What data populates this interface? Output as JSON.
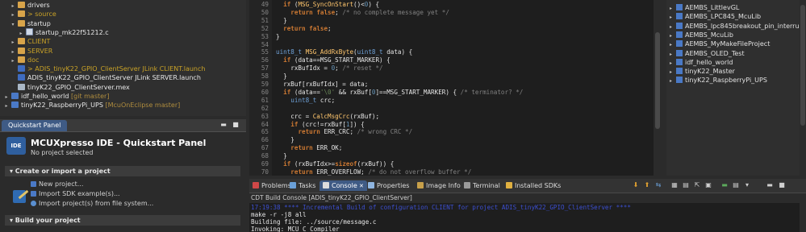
{
  "explorer": {
    "rows": [
      {
        "indent": 1,
        "twisty": "▸",
        "icon": "folder",
        "label": "drivers",
        "cls": "c-white"
      },
      {
        "indent": 1,
        "twisty": "▸",
        "icon": "folder",
        "label": "> source",
        "cls": "c-gold"
      },
      {
        "indent": 1,
        "twisty": "▾",
        "icon": "folder",
        "label": "startup",
        "cls": "c-white"
      },
      {
        "indent": 2,
        "twisty": "▸",
        "icon": "file",
        "label": "startup_mk22f51212.c",
        "cls": "c-white"
      },
      {
        "indent": 1,
        "twisty": "▸",
        "icon": "folder",
        "label": "CLIENT",
        "cls": "c-gold"
      },
      {
        "indent": 1,
        "twisty": "▸",
        "icon": "folder",
        "label": "SERVER",
        "cls": "c-gold"
      },
      {
        "indent": 1,
        "twisty": "▸",
        "icon": "folder",
        "label": "doc",
        "cls": "c-gold"
      },
      {
        "indent": 1,
        "twisty": "",
        "icon": "launch",
        "label": "> ADIS_tinyK22_GPIO_ClientServer JLink CLIENT.launch",
        "cls": "c-gold"
      },
      {
        "indent": 1,
        "twisty": "",
        "icon": "launch",
        "label": "ADIS_tinyK22_GPIO_ClientServer JLink SERVER.launch",
        "cls": "c-white"
      },
      {
        "indent": 1,
        "twisty": "",
        "icon": "mex",
        "label": "tinyK22_GPIO_ClientServer.mex",
        "cls": "c-white"
      },
      {
        "indent": 0,
        "twisty": "▸",
        "icon": "proj",
        "label": "idf_hello_world",
        "ann": " [git master]",
        "cls": "c-white"
      },
      {
        "indent": 0,
        "twisty": "▸",
        "icon": "proj",
        "label": "tinyK22_RaspberryPi_UPS",
        "ann": " [McuOnEclipse master]",
        "cls": "c-white"
      }
    ]
  },
  "quickstart": {
    "tab_label": "Quickstart Panel",
    "logo_text": "IDE",
    "title": "MCUXpresso IDE - Quickstart Panel",
    "subtitle": "No project selected",
    "section1": "▾  Create or import a project",
    "items": [
      "New project...",
      "Import SDK example(s)...",
      "Import project(s) from file system..."
    ],
    "section2": "▾  Build your project",
    "minimize": "▬",
    "maximize": "■"
  },
  "editor": {
    "lines": [
      {
        "n": "49",
        "html": "  <span class='kw'>if</span> (<span class='fn'>MSG_SyncOnStart</span>()&lt;<span class='nm'>0</span>) {"
      },
      {
        "n": "50",
        "html": "    <span class='kw'>return</span> <span class='kw'>false</span>; <span class='cm'>/* no complete message yet */</span>"
      },
      {
        "n": "51",
        "html": "  }"
      },
      {
        "n": "52",
        "html": "  <span class='kw'>return</span> <span class='kw'>false</span>;"
      },
      {
        "n": "53",
        "html": "}"
      },
      {
        "n": "54",
        "html": ""
      },
      {
        "n": "55",
        "html": "<span class='tp'>uint8_t</span> <span class='fn'>MSG_AddRxByte</span>(<span class='tp'>uint8_t</span> data) {"
      },
      {
        "n": "56",
        "html": "  <span class='kw'>if</span> (data==MSG_START_MARKER) {"
      },
      {
        "n": "57",
        "html": "    rxBufIdx = <span class='nm'>0</span>; <span class='cm'>/* reset */</span>"
      },
      {
        "n": "58",
        "html": "  }"
      },
      {
        "n": "59",
        "html": "  rxBuf[rxBufIdx] = data;"
      },
      {
        "n": "60",
        "html": "  <span class='kw'>if</span> (data==<span class='st'>'\\0'</span> &amp;&amp; rxBuf[<span class='nm'>0</span>]==MSG_START_MARKER) { <span class='cm'>/* terminator? */</span>"
      },
      {
        "n": "61",
        "html": "    <span class='tp'>uint8_t</span> crc;"
      },
      {
        "n": "62",
        "html": ""
      },
      {
        "n": "63",
        "html": "    crc = <span class='fn'>CalcMsgCrc</span>(rxBuf);"
      },
      {
        "n": "64",
        "html": "    <span class='kw'>if</span> (crc!=rxBuf[<span class='nm'>1</span>]) {"
      },
      {
        "n": "65",
        "html": "      <span class='kw'>return</span> ERR_CRC; <span class='cm'>/* wrong CRC */</span>"
      },
      {
        "n": "66",
        "html": "    }"
      },
      {
        "n": "67",
        "html": "    <span class='kw'>return</span> ERR_OK;"
      },
      {
        "n": "68",
        "html": "  }"
      },
      {
        "n": "69",
        "html": "  <span class='kw'>if</span> (rxBufIdx&gt;=<span class='kw'>sizeof</span>(rxBuf)) {"
      },
      {
        "n": "70",
        "html": "    <span class='kw'>return</span> ERR_OVERFLOW; <span class='cm'>/* do not overflow buffer */</span>"
      }
    ]
  },
  "projects": {
    "items": [
      "AEMBS_LittlevGL",
      "AEMBS_LPC845_McuLib",
      "AEMBS_lpc845breakout_pin_interrupt",
      "AEMBS_McuLib",
      "AEMBS_MyMakeFileProject",
      "AEMBS_OLED_Test",
      "idf_hello_world",
      "tinyK22_Master",
      "tinyK22_RaspberryPi_UPS"
    ]
  },
  "console": {
    "tabs": [
      {
        "label": "Problems",
        "color": "#d04848",
        "icon": "problems-icon"
      },
      {
        "label": "Tasks",
        "color": "#6aa0d8",
        "icon": "tasks-icon"
      },
      {
        "label": "Console",
        "color": "#dddddd",
        "icon": "console-icon",
        "active": true,
        "close": "✕"
      },
      {
        "label": "Properties",
        "color": "#8fb5e0",
        "icon": "properties-icon"
      },
      {
        "label": "Image Info",
        "color": "#c8a04a",
        "icon": "image-info-icon"
      },
      {
        "label": "Terminal",
        "color": "#9a9a9a",
        "icon": "terminal-icon"
      },
      {
        "label": "Installed SDKs",
        "color": "#e0b040",
        "icon": "sdk-icon"
      }
    ],
    "title": "CDT Build Console [ADIS_tinyK22_GPIO_ClientServer]",
    "lines": [
      {
        "text": "17:19:38 **** Incremental Build of configuration CLIENT for project ADIS_tinyK22_GPIO_ClientServer ****",
        "color": "#3c4fd0"
      },
      {
        "text": "make -r -j8 all",
        "color": "#e6e6e6"
      },
      {
        "text": "Building file: ../source/message.c",
        "color": "#e6e6e6"
      },
      {
        "text": "Invoking: MCU C Compiler",
        "color": "#e6e6e6"
      }
    ],
    "toolbar": [
      "⬇",
      "⬆",
      "⇆",
      "▦",
      "▤",
      "⇱",
      "▣",
      "▬",
      "▤",
      "▾",
      "▬",
      "■"
    ],
    "toolbar_colors": [
      "#e0a030",
      "#e0a030",
      "#6aa0d8",
      "#cfcfcf",
      "#cfcfcf",
      "#cfcfcf",
      "#cfcfcf",
      "#5caa5c",
      "#cfcfcf",
      "#cfcfcf",
      "#cfcfcf",
      "#cfcfcf"
    ]
  }
}
